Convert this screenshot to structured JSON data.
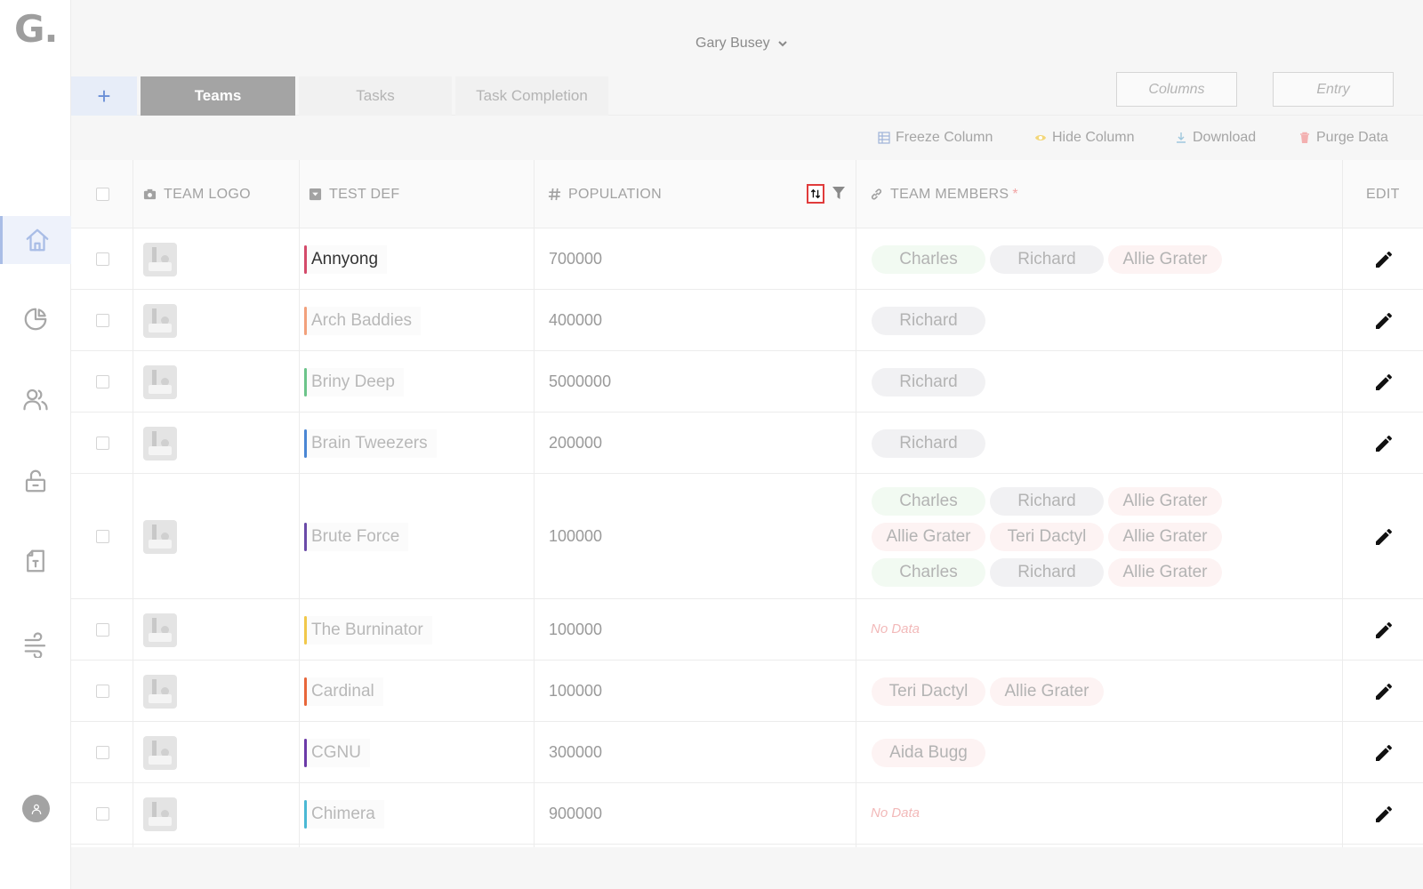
{
  "app": {
    "logo": "G."
  },
  "sidebar": {
    "items": [
      {
        "icon": "home-icon"
      },
      {
        "icon": "pie-chart-icon"
      },
      {
        "icon": "users-icon"
      },
      {
        "icon": "unlock-icon"
      },
      {
        "icon": "document-icon"
      },
      {
        "icon": "wind-icon"
      }
    ],
    "avatar_icon": "user-avatar-icon"
  },
  "header": {
    "user_name": "Gary Busey"
  },
  "tabs": {
    "add_label": "+",
    "items": [
      {
        "label": "Teams",
        "active": true
      },
      {
        "label": "Tasks",
        "active": false
      },
      {
        "label": "Task Completion",
        "active": false
      }
    ]
  },
  "header_buttons": {
    "columns": "Columns",
    "entry": "Entry"
  },
  "toolbar": {
    "freeze": "Freeze Column",
    "hide": "Hide Column",
    "download": "Download",
    "purge": "Purge Data"
  },
  "table": {
    "columns": {
      "logo": "TEAM LOGO",
      "def": "TEST DEF",
      "population": "POPULATION",
      "members": "TEAM MEMBERS",
      "members_required": "*",
      "edit": "EDIT"
    },
    "no_data": "No Data",
    "rows": [
      {
        "name": "Annyong",
        "color": "#d44a6a",
        "population": "700000",
        "members": [
          "Charles",
          "Richard",
          "Allie Grater"
        ]
      },
      {
        "name": "Arch Baddies",
        "color": "#f2a07b",
        "population": "400000",
        "members": [
          "Richard"
        ]
      },
      {
        "name": "Briny Deep",
        "color": "#6cc48a",
        "population": "5000000",
        "members": [
          "Richard"
        ]
      },
      {
        "name": "Brain Tweezers",
        "color": "#4a86d4",
        "population": "200000",
        "members": [
          "Richard"
        ]
      },
      {
        "name": "Brute Force",
        "color": "#6a4aa8",
        "population": "100000",
        "members": [
          "Charles",
          "Richard",
          "Allie Grater",
          "Allie Grater",
          "Teri Dactyl",
          "Allie Grater",
          "Charles",
          "Richard",
          "Allie Grater"
        ]
      },
      {
        "name": "The Burninator",
        "color": "#f1c84a",
        "population": "100000",
        "members": []
      },
      {
        "name": "Cardinal",
        "color": "#e8663a",
        "population": "100000",
        "members": [
          "Teri Dactyl",
          "Allie Grater"
        ]
      },
      {
        "name": "CGNU",
        "color": "#6b3aa8",
        "population": "300000",
        "members": [
          "Aida Bugg"
        ]
      },
      {
        "name": "Chimera",
        "color": "#4ab8d4",
        "population": "900000",
        "members": []
      }
    ]
  }
}
